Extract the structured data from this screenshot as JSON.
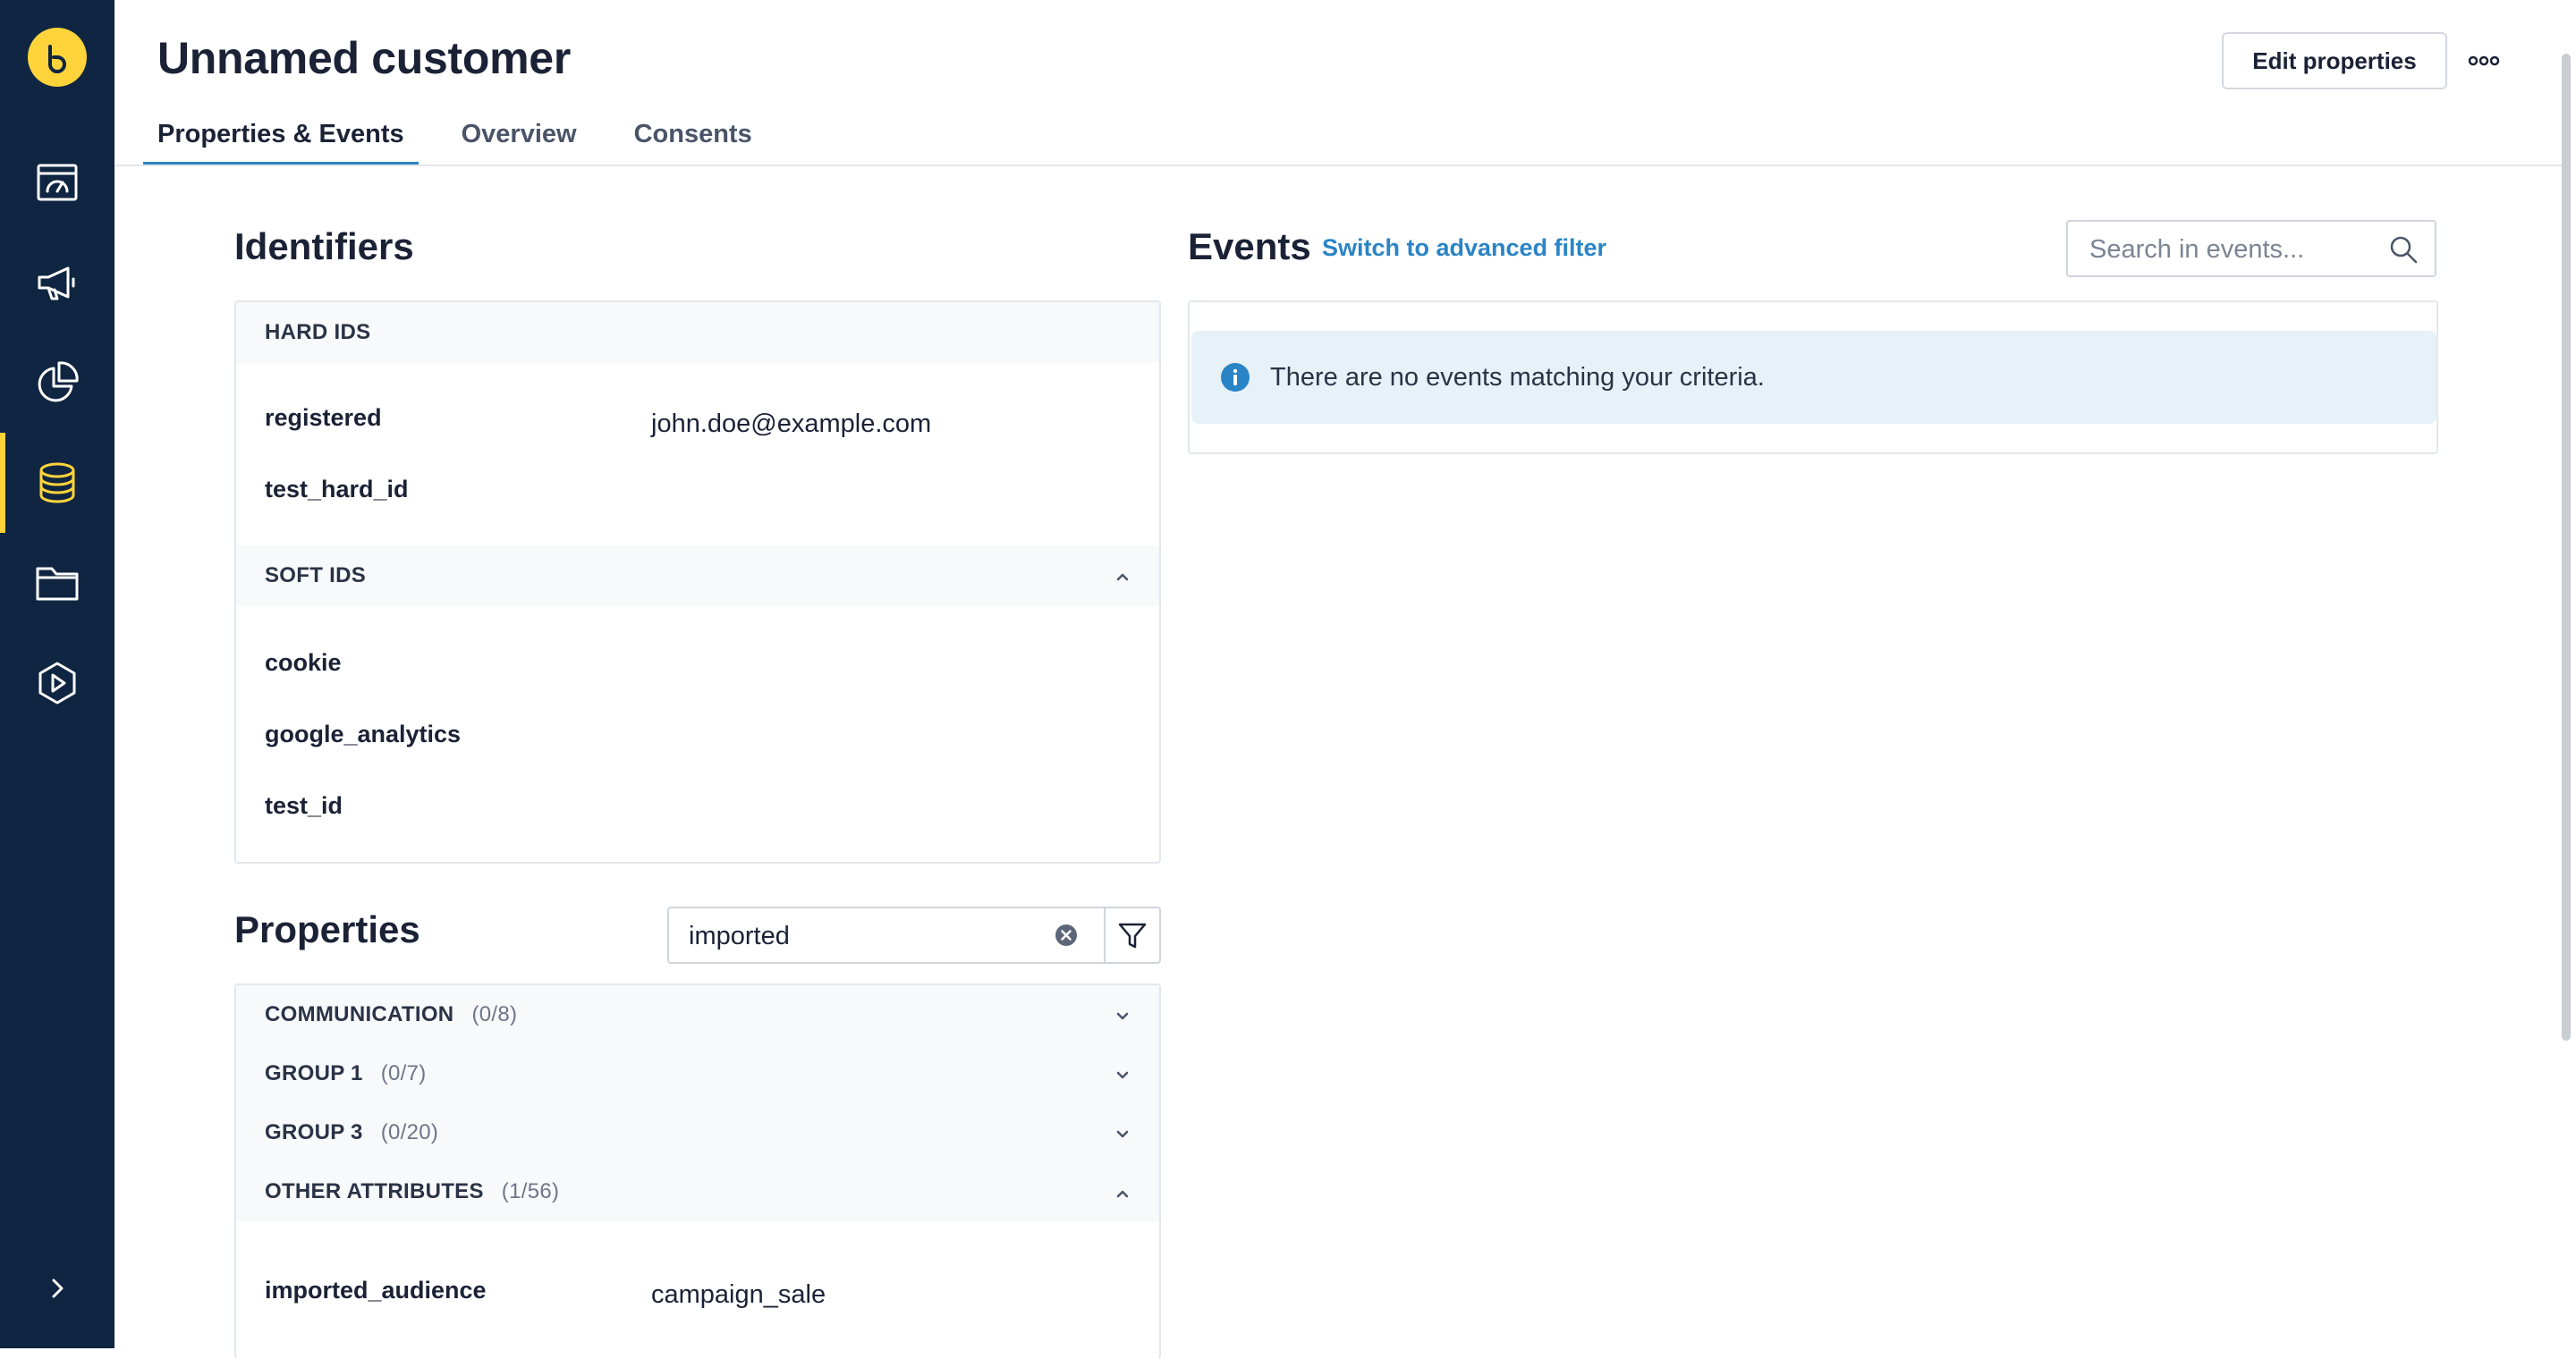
{
  "header": {
    "title": "Unnamed customer",
    "edit_button": "Edit properties",
    "more_icon": "more-horizontal-icon"
  },
  "tabs": [
    {
      "label": "Properties & Events",
      "active": true
    },
    {
      "label": "Overview",
      "active": false
    },
    {
      "label": "Consents",
      "active": false
    }
  ],
  "sidebar": {
    "logo_icon": "brand-logo-icon",
    "items": [
      {
        "icon": "dashboard-icon",
        "active": false
      },
      {
        "icon": "megaphone-icon",
        "active": false
      },
      {
        "icon": "pie-chart-icon",
        "active": false
      },
      {
        "icon": "database-icon",
        "active": true
      },
      {
        "icon": "folder-icon",
        "active": false
      },
      {
        "icon": "play-hexagon-icon",
        "active": false
      }
    ],
    "expand_icon": "chevron-right-icon"
  },
  "identifiers": {
    "title": "Identifiers",
    "hard_ids": {
      "heading": "HARD IDS",
      "rows": [
        {
          "label": "registered",
          "value": "john.doe@example.com"
        },
        {
          "label": "test_hard_id",
          "value": ""
        }
      ]
    },
    "soft_ids": {
      "heading": "SOFT IDS",
      "expanded": true,
      "rows": [
        {
          "label": "cookie",
          "value": ""
        },
        {
          "label": "google_analytics",
          "value": ""
        },
        {
          "label": "test_id",
          "value": ""
        }
      ]
    }
  },
  "properties": {
    "title": "Properties",
    "search_value": "imported",
    "groups": [
      {
        "name": "COMMUNICATION",
        "count": "(0/8)",
        "expanded": false
      },
      {
        "name": "GROUP 1",
        "count": "(0/7)",
        "expanded": false
      },
      {
        "name": "GROUP 3",
        "count": "(0/20)",
        "expanded": false
      },
      {
        "name": "OTHER ATTRIBUTES",
        "count": "(1/56)",
        "expanded": true
      }
    ],
    "rows": [
      {
        "label": "imported_audience",
        "value": "campaign_sale"
      }
    ]
  },
  "events": {
    "title": "Events",
    "advanced_filter_link": "Switch to advanced filter",
    "search_placeholder": "Search in events...",
    "empty_message": "There are no events matching your criteria."
  },
  "colors": {
    "sidebar_bg": "#0f2541",
    "accent_yellow": "#ffd43a",
    "link_blue": "#2a84c5",
    "info_bg": "#e6f1f8"
  }
}
